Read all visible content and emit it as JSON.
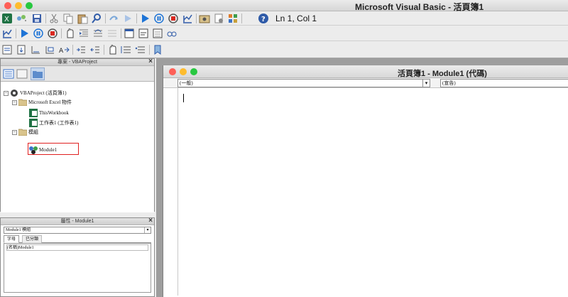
{
  "window": {
    "title": "Microsoft Visual Basic - 活頁簿1",
    "status_position": "Ln 1, Col 1"
  },
  "project_pane": {
    "header": "專案 - VBAProject",
    "tree": {
      "root": "VBAProject (活頁簿1)",
      "excel_objects_folder": "Microsoft Excel 物件",
      "workbook": "ThisWorkbook",
      "sheet": "工作表1 (工作表1)",
      "modules_folder": "模組",
      "module": "Module1"
    }
  },
  "properties_pane": {
    "header": "屬性 - Module1",
    "object_select": "Module1  模組",
    "tabs": [
      "字母",
      "已分類"
    ],
    "row_name": "(名稱)",
    "row_value": "Module1"
  },
  "code_window": {
    "title": "活頁簿1 - Module1 (代碼)",
    "object_combo": "(一般)",
    "procedure_combo": "(宣告)"
  },
  "colors": {
    "close_light": "#fe5f57",
    "min_light": "#febc2e",
    "max_light": "#28c840",
    "run_blue": "#1e74d6",
    "stop_red": "#d9281f",
    "highlight": "#e02020"
  }
}
